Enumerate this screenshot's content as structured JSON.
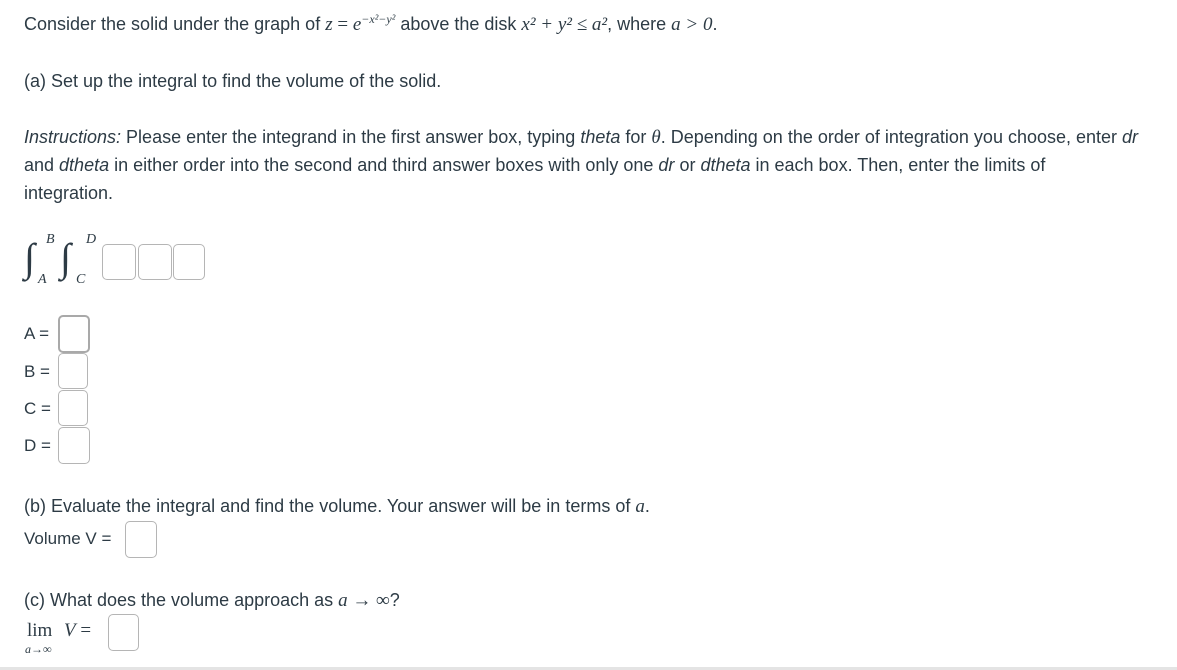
{
  "problem": {
    "intro_prefix": "Consider the solid under the graph of ",
    "intro_eq_lhs": "z",
    "intro_eq_rhs": "e",
    "intro_exponent": "−x²−y²",
    "intro_mid": " above the disk ",
    "intro_disk": "x² + y² ≤ a²",
    "intro_where": ", where ",
    "intro_cond": "a > 0",
    "intro_end": "."
  },
  "part_a": {
    "prompt": "(a) Set up the integral to find the volume of the solid.",
    "instructions_label": "Instructions:",
    "instructions_line1_a": " Please enter the integrand in the first answer box, typing ",
    "theta_word": "theta",
    "instructions_line1_b": " for ",
    "theta_symbol": "θ",
    "instructions_line1_c": ". Depending on the order of integration you choose, enter ",
    "dr_word": "dr",
    "instructions_line2_a": "and ",
    "dtheta_word": "dtheta",
    "instructions_line2_b": " in either order into the second and third answer boxes with only one ",
    "instructions_line2_c": " or ",
    "instructions_line2_d": " in each box. Then, enter the limits of",
    "instructions_line3": "integration.",
    "integral": {
      "outer_upper": "B",
      "outer_lower": "A",
      "inner_upper": "D",
      "inner_lower": "C"
    },
    "limits": [
      {
        "label": "A =",
        "value": ""
      },
      {
        "label": "B =",
        "value": ""
      },
      {
        "label": "C =",
        "value": ""
      },
      {
        "label": "D =",
        "value": ""
      }
    ],
    "integrand_value": "",
    "differential_1_value": "",
    "differential_2_value": ""
  },
  "part_b": {
    "prompt_prefix": "(b) Evaluate the integral and find the volume. Your answer will be in terms of ",
    "prompt_var": "a",
    "prompt_end": ".",
    "volume_label": "Volume V =",
    "volume_value": ""
  },
  "part_c": {
    "prompt_prefix": "(c) What does the volume approach as ",
    "prompt_limit": "a → ∞",
    "prompt_end": "?",
    "lim_word": "lim",
    "lim_sub": "a→∞",
    "lim_expr": "V =",
    "lim_value": ""
  }
}
